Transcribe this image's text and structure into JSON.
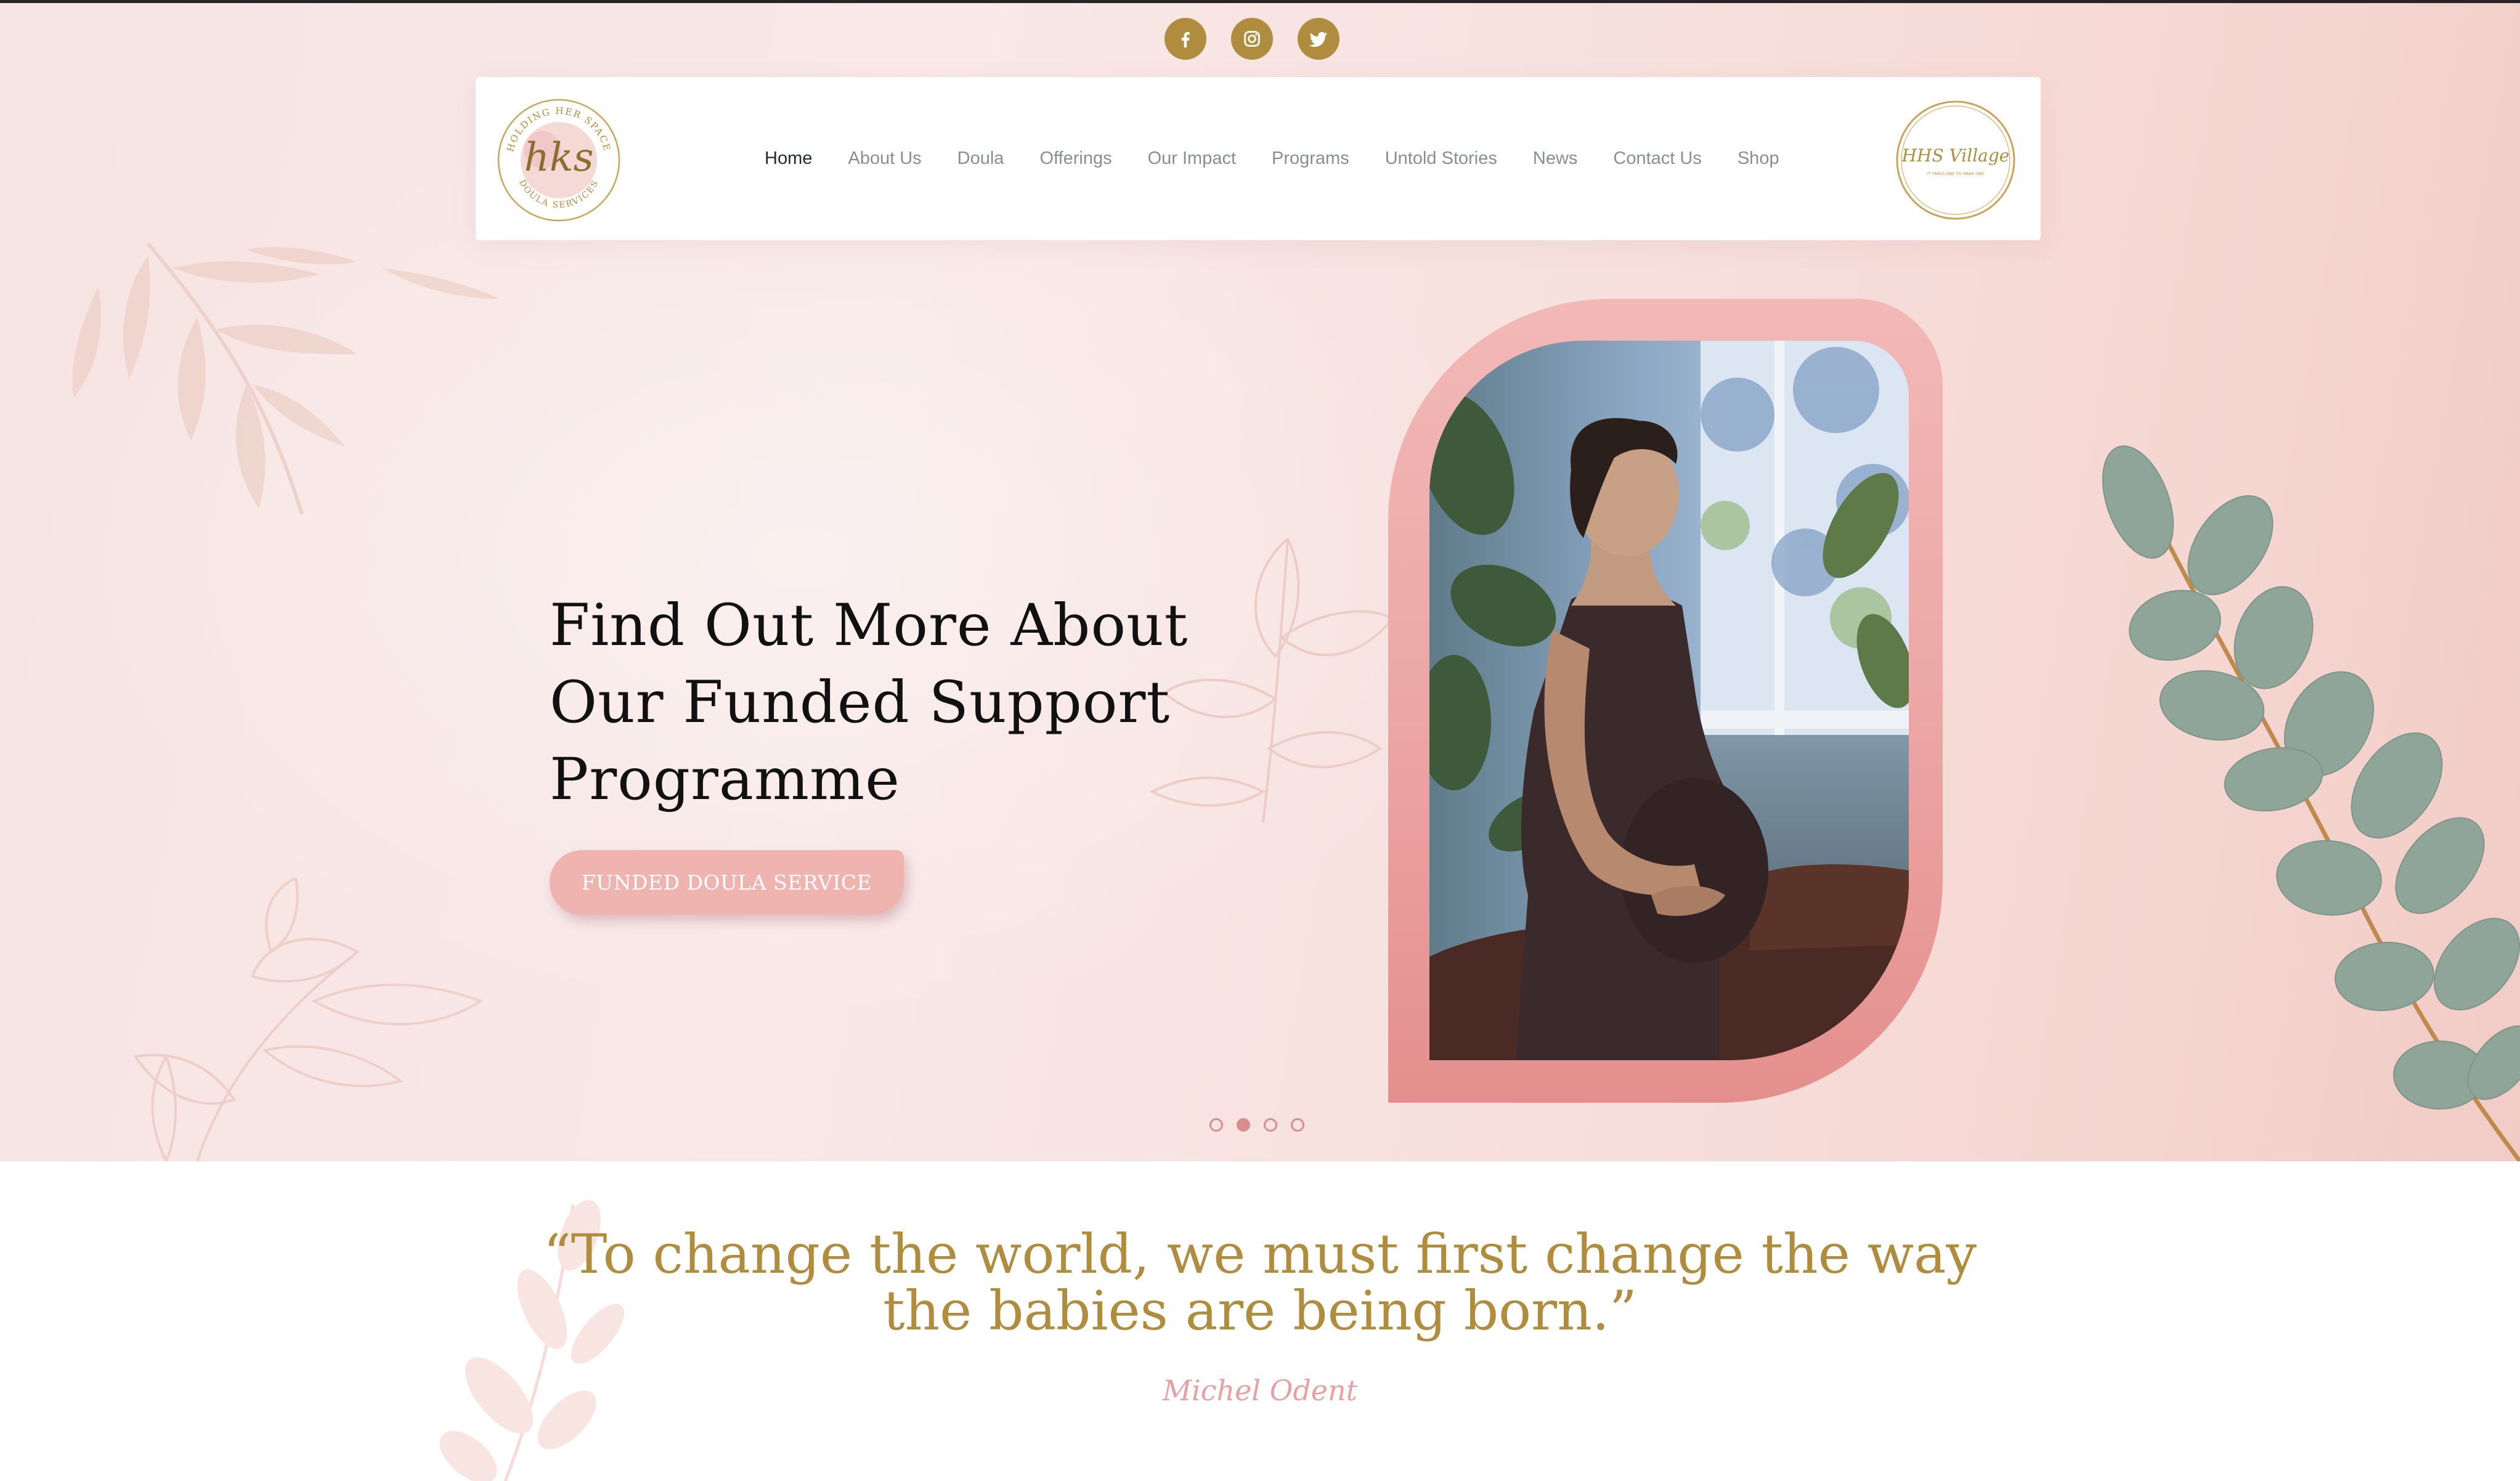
{
  "social": [
    {
      "name": "facebook-icon"
    },
    {
      "name": "instagram-icon"
    },
    {
      "name": "twitter-icon"
    }
  ],
  "header": {
    "logo_left": {
      "monogram": "hks",
      "ring_top": "HOLDING HER SPACE",
      "ring_bottom": "DOULA SERVICES"
    },
    "logo_right": {
      "monogram": "HHS Village",
      "tagline": "IT TAKES ONE TO MAKE ONE"
    }
  },
  "nav": {
    "items": [
      "Home",
      "About Us",
      "Doula",
      "Offerings",
      "Our Impact",
      "Programs",
      "Untold Stories",
      "News",
      "Contact Us",
      "Shop"
    ],
    "active": "Home"
  },
  "hero": {
    "headline_lines": [
      "Find Out More About",
      "Our Funded Support",
      "Programme"
    ],
    "cta_label": "FUNDED DOULA SERVICE",
    "slides": 4,
    "active_slide": 2
  },
  "quote": {
    "line1": "“To change the world, we must first change the way",
    "line2": "the babies are being born.”",
    "author": "Michel Odent"
  },
  "colors": {
    "gold": "#b08d3e",
    "pink": "#efb3b0",
    "frame_pink": "#eca7a5",
    "hero_bg": "#f7e4e2",
    "author_pink": "#e7a0a3"
  }
}
